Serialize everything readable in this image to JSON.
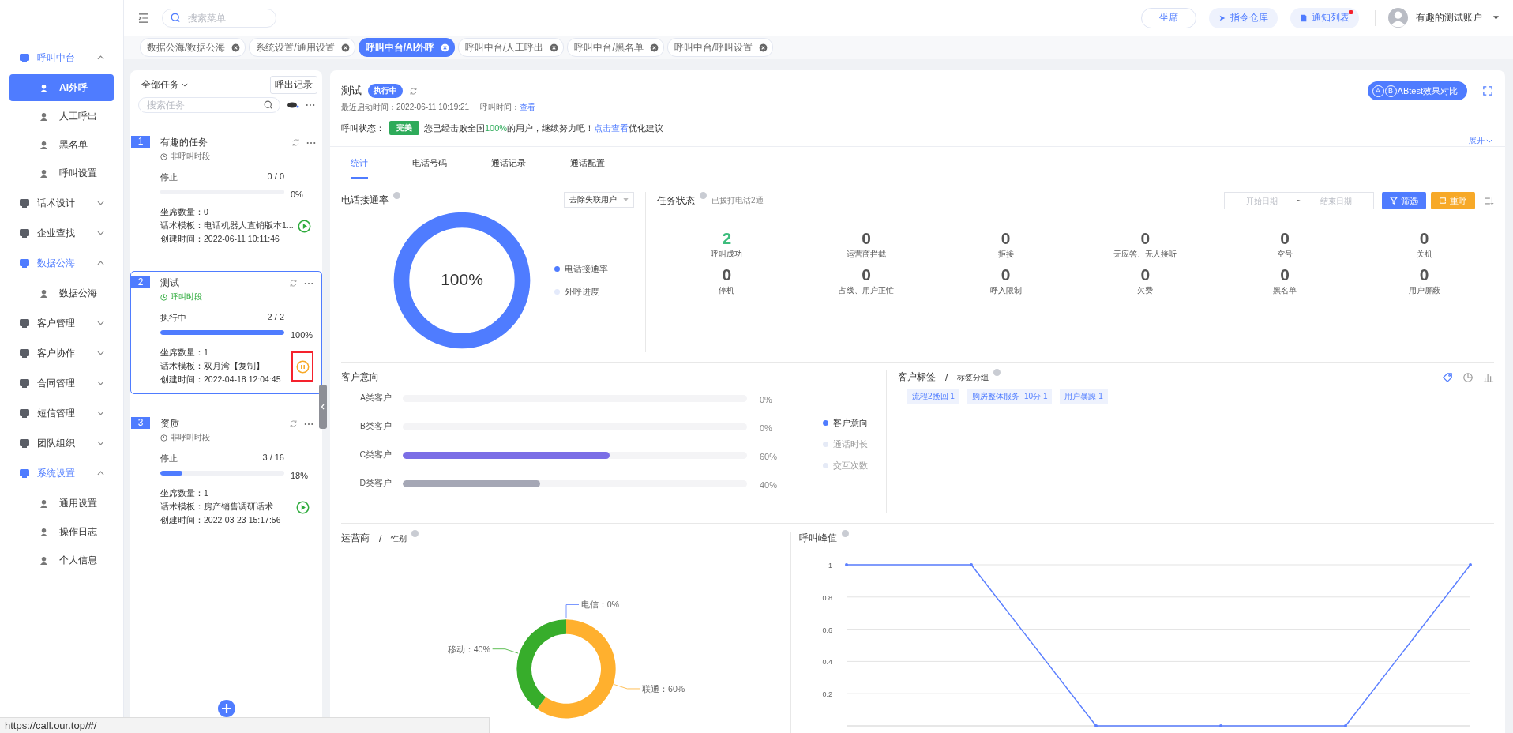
{
  "sidebar": {
    "items": [
      {
        "label": "呼叫中台",
        "expanded": true,
        "children": [
          {
            "label": "AI外呼",
            "selected": true
          },
          {
            "label": "人工呼出",
            "selected": false
          },
          {
            "label": "黑名单",
            "selected": false
          },
          {
            "label": "呼叫设置",
            "selected": false
          }
        ]
      },
      {
        "label": "话术设计",
        "expanded": false
      },
      {
        "label": "企业查找",
        "expanded": false
      },
      {
        "label": "数据公海",
        "expanded": true,
        "children": [
          {
            "label": "数据公海",
            "selected": false
          }
        ]
      },
      {
        "label": "客户管理",
        "expanded": false
      },
      {
        "label": "客户协作",
        "expanded": false
      },
      {
        "label": "合同管理",
        "expanded": false
      },
      {
        "label": "短信管理",
        "expanded": false
      },
      {
        "label": "团队组织",
        "expanded": false
      },
      {
        "label": "系统设置",
        "expanded": true,
        "children": [
          {
            "label": "通用设置",
            "selected": false
          },
          {
            "label": "操作日志",
            "selected": false
          },
          {
            "label": "个人信息",
            "selected": false
          }
        ]
      }
    ]
  },
  "topbar": {
    "search": {
      "placeholder": "搜索菜单"
    },
    "buttons": [
      {
        "label": "坐席",
        "kind": "outline",
        "notification": false
      },
      {
        "label": "指令仓库",
        "kind": "command",
        "notification": false
      },
      {
        "label": "通知列表",
        "kind": "notice",
        "notification": true
      }
    ],
    "user": "有趣的测试账户"
  },
  "page_tabs": [
    {
      "label": "数据公海/数据公海",
      "selected": false
    },
    {
      "label": "系统设置/通用设置",
      "selected": false
    },
    {
      "label": "呼叫中台/AI外呼",
      "selected": true
    },
    {
      "label": "呼叫中台/人工呼出",
      "selected": false
    },
    {
      "label": "呼叫中台/黑名单",
      "selected": false
    },
    {
      "label": "呼叫中台/呼叫设置",
      "selected": false
    }
  ],
  "task_list": {
    "filter": "全部任务",
    "records_button": "呼出记录",
    "search": {
      "placeholder": "搜索任务"
    },
    "tasks": [
      {
        "index": "1",
        "name": "有趣的任务",
        "period": "非呼叫时段",
        "period_active": false,
        "status": "停止",
        "count": "0 / 0",
        "level": 0,
        "percent": "0%",
        "seats": "坐席数量：0",
        "template": "话术模板：电话机器人直销版本1...",
        "created": "创建时间：2022-06-11 10:11:46",
        "kind": "play",
        "action_highlighted": false,
        "selected": false
      },
      {
        "index": "2",
        "name": "测试",
        "period": "呼叫时段",
        "period_active": true,
        "status": "执行中",
        "count": "2 / 2",
        "level": 1,
        "percent": "100%",
        "seats": "坐席数量：1",
        "template": "话术模板：双月湾【复制】",
        "created": "创建时间：2022-04-18 12:04:45",
        "kind": "pause",
        "action_highlighted": true,
        "selected": true
      },
      {
        "index": "3",
        "name": "资质",
        "period": "非呼叫时段",
        "period_active": false,
        "status": "停止",
        "count": "3 / 16",
        "level": 0.18,
        "percent": "18%",
        "seats": "坐席数量：1",
        "template": "话术模板：房产销售调研话术",
        "created": "创建时间：2022-03-23 15:17:56",
        "kind": "play",
        "action_highlighted": false,
        "selected": false
      }
    ]
  },
  "header": {
    "title": "测试",
    "status": "执行中",
    "last_start": "最近启动时间：2022-06-11 10:19:21",
    "call_time_label": "呼叫时间：",
    "call_time_link": "查看",
    "call_status_label": "呼叫状态：",
    "call_status": "完美",
    "message": {
      "before": "您已经击败全国",
      "highlight": "100%",
      "after": "的用户，继续努力吧！",
      "link": "点击查看",
      "link_after": "优化建议"
    },
    "ab_letters": [
      "A",
      "B"
    ],
    "ab_button": "ABtest效果对比",
    "expand": "展开"
  },
  "tabs": [
    {
      "label": "统计",
      "selected": true
    },
    {
      "label": "电话号码",
      "selected": false
    },
    {
      "label": "通话记录",
      "selected": false
    },
    {
      "label": "通话配置",
      "selected": false
    }
  ],
  "connect_rate": {
    "title": "电话接通率",
    "select": "去除失联用户",
    "level": 1,
    "center": "100%",
    "legend": [
      {
        "label": "电话接通率",
        "color": "#4f7cff"
      },
      {
        "label": "外呼进度",
        "color": "#e4eafb"
      }
    ]
  },
  "task_status": {
    "title": "任务状态",
    "hint": "已拨打电话2通",
    "date_start": {
      "placeholder": "开始日期"
    },
    "date_sep": "~",
    "date_end": {
      "placeholder": "结束日期"
    },
    "filter_button": "筛选",
    "recall_button": "重呼",
    "stats": [
      {
        "value": "2",
        "label": "呼叫成功",
        "color": "#3dbd7d"
      },
      {
        "value": "0",
        "label": "运营商拦截",
        "color": "#555555"
      },
      {
        "value": "0",
        "label": "拒接",
        "color": "#555555"
      },
      {
        "value": "0",
        "label": "无应答、无人接听",
        "color": "#555555"
      },
      {
        "value": "0",
        "label": "空号",
        "color": "#555555"
      },
      {
        "value": "0",
        "label": "关机",
        "color": "#555555"
      },
      {
        "value": "0",
        "label": "停机",
        "color": "#555555"
      },
      {
        "value": "0",
        "label": "占线、用户正忙",
        "color": "#555555"
      },
      {
        "value": "0",
        "label": "呼入限制",
        "color": "#555555"
      },
      {
        "value": "0",
        "label": "欠费",
        "color": "#555555"
      },
      {
        "value": "0",
        "label": "黑名单",
        "color": "#555555"
      },
      {
        "value": "0",
        "label": "用户屏蔽",
        "color": "#555555"
      }
    ]
  },
  "intent": {
    "title": "客户意向",
    "rows": [
      {
        "label": "A类客户",
        "level": 0,
        "percent": "0%"
      },
      {
        "label": "B类客户",
        "level": 0,
        "percent": "0%"
      },
      {
        "label": "C类客户",
        "level": 0.6,
        "percent": "60%",
        "color": "#7b6ee6"
      },
      {
        "label": "D类客户",
        "level": 0.4,
        "percent": "40%",
        "color": "#a5a7b5"
      }
    ],
    "legend": [
      {
        "label": "客户意向",
        "selected": true
      },
      {
        "label": "通话时长",
        "selected": false
      },
      {
        "label": "交互次数",
        "selected": false
      }
    ]
  },
  "tags": {
    "title": "客户标签",
    "sep": "/",
    "subtitle": "标签分组",
    "items": [
      "流程2挽回 1",
      "购房整体服务- 10分 1",
      "用户暴躁 1"
    ],
    "views": [
      {
        "kind": "tag",
        "selected": true
      },
      {
        "kind": "pie",
        "selected": false
      },
      {
        "kind": "bar",
        "selected": false
      }
    ]
  },
  "carrier": {
    "title": "运营商",
    "sep": "/",
    "subtitle": "性别",
    "label_sep": "：",
    "chart_data": {
      "type": "donut",
      "categories": [
        "电信",
        "联通",
        "移动"
      ],
      "values": [
        0,
        60,
        40
      ],
      "colors": [
        "#5b7fff",
        "#ffb02e",
        "#37ad2b"
      ],
      "value_labels": [
        "0%",
        "60%",
        "40%"
      ]
    }
  },
  "peak": {
    "title": "呼叫峰值",
    "chart_data": {
      "type": "line",
      "grid": true,
      "ylim": [
        0,
        1
      ],
      "yticks": [
        0.2,
        0.4,
        0.6,
        0.8,
        1
      ],
      "series": [
        {
          "color": "#5b7fff",
          "values": [
            1,
            1,
            0,
            0,
            0,
            1
          ]
        }
      ]
    }
  },
  "status_bar": "https://call.our.top/#/"
}
